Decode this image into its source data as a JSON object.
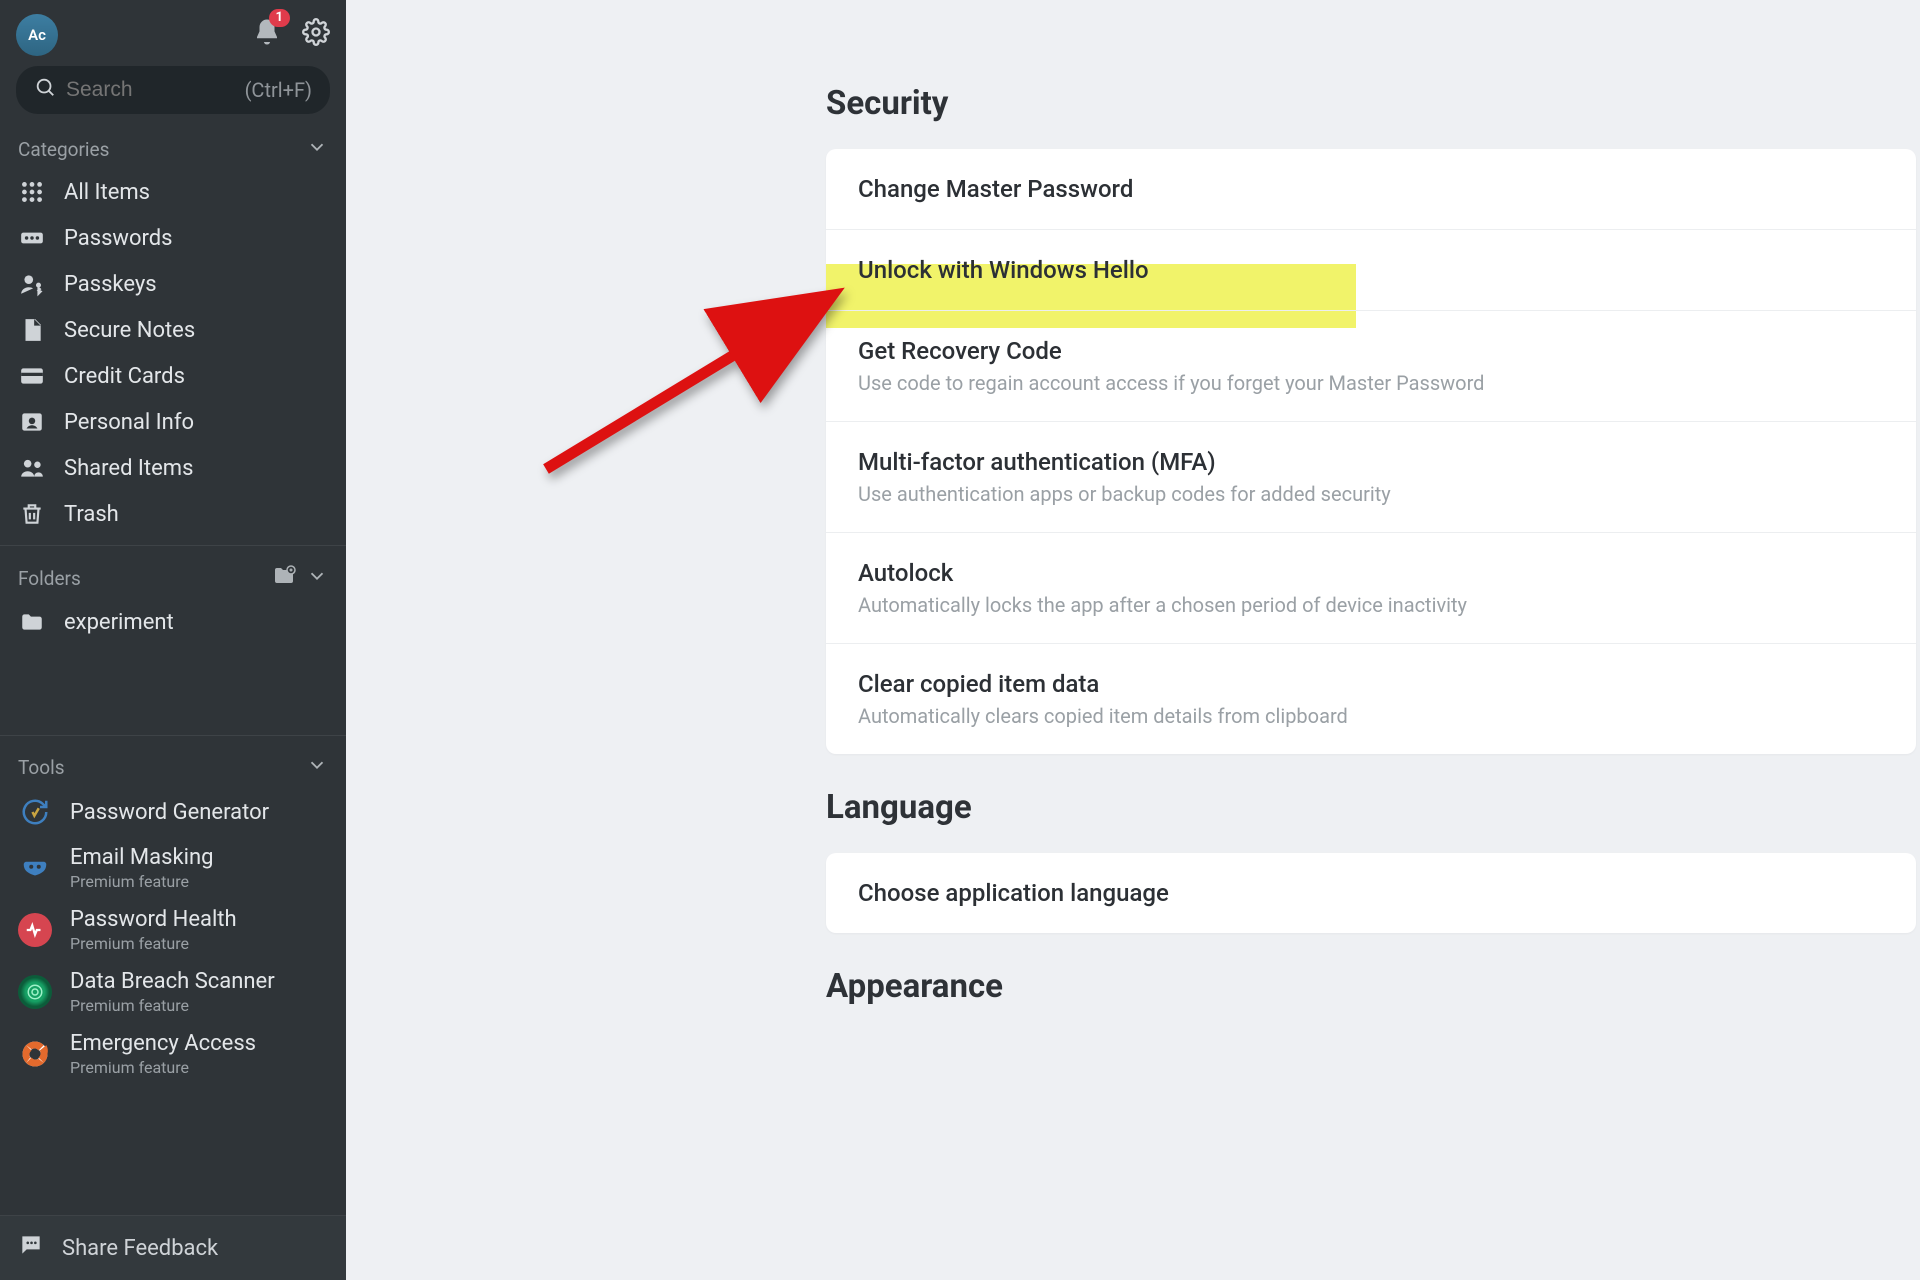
{
  "header": {
    "avatar_initials": "Ac",
    "notification_count": "1"
  },
  "search": {
    "placeholder": "Search",
    "hint": "(Ctrl+F)"
  },
  "sidebar": {
    "categories_label": "Categories",
    "categories": [
      {
        "label": "All Items"
      },
      {
        "label": "Passwords"
      },
      {
        "label": "Passkeys"
      },
      {
        "label": "Secure Notes"
      },
      {
        "label": "Credit Cards"
      },
      {
        "label": "Personal Info"
      },
      {
        "label": "Shared Items"
      },
      {
        "label": "Trash"
      }
    ],
    "folders_label": "Folders",
    "folders": [
      {
        "label": "experiment"
      }
    ],
    "tools_label": "Tools",
    "premium_label": "Premium feature",
    "tools": [
      {
        "label": "Password Generator"
      },
      {
        "label": "Email Masking"
      },
      {
        "label": "Password Health"
      },
      {
        "label": "Data Breach Scanner"
      },
      {
        "label": "Emergency Access"
      }
    ],
    "footer_label": "Share Feedback"
  },
  "settings": {
    "security": {
      "title": "Security",
      "rows": [
        {
          "title": "Change Master Password"
        },
        {
          "title": "Unlock with Windows Hello"
        },
        {
          "title": "Get Recovery Code",
          "sub": "Use code to regain account access if you forget your Master Password"
        },
        {
          "title": "Multi-factor authentication (MFA)",
          "sub": "Use authentication apps or backup codes for added security"
        },
        {
          "title": "Autolock",
          "sub": "Automatically locks the app after a chosen period of device inactivity"
        },
        {
          "title": "Clear copied item data",
          "sub": "Automatically clears copied item details from clipboard"
        }
      ]
    },
    "language": {
      "title": "Language",
      "rows": [
        {
          "title": "Choose application language"
        }
      ]
    },
    "appearance": {
      "title": "Appearance"
    }
  }
}
